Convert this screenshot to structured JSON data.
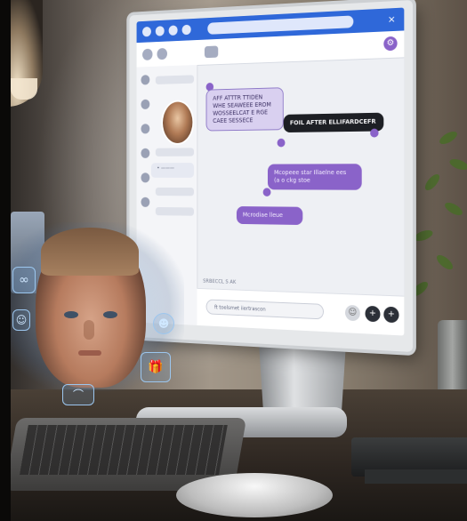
{
  "scene": {
    "description_tags": [
      "desktop-monitor",
      "chat-app",
      "hologram-boy",
      "keyboard",
      "mouse",
      "plant"
    ]
  },
  "chat_app": {
    "accent_color": "#8a63c9",
    "topbar_color": "#2f68d9",
    "active_contact": "• ———",
    "messages": [
      {
        "text": "AFF ATTTR TTIDEN\nWHE SEAWEEE EROM\nWOSSEELCAT E RGE\nCAEE SESSECE"
      },
      {
        "text": "FOIL AFTER ELLIFARDCEFR"
      },
      {
        "text": "Mcopeee star Illaelne ees\n(a o ckg stoe"
      },
      {
        "text": "Mcrodiae lleue"
      }
    ],
    "status_line": "SRBECCL S AK",
    "input_placeholder": "ft toelsmet iiertrascon",
    "add_button_label": "+",
    "send_button_label": "+",
    "emoji_button_label": "☺",
    "close_glyph": "×"
  },
  "holo": {
    "icons": [
      "link-icon",
      "user-icon",
      "gift-icon",
      "face-icon",
      "chat-icon"
    ]
  }
}
